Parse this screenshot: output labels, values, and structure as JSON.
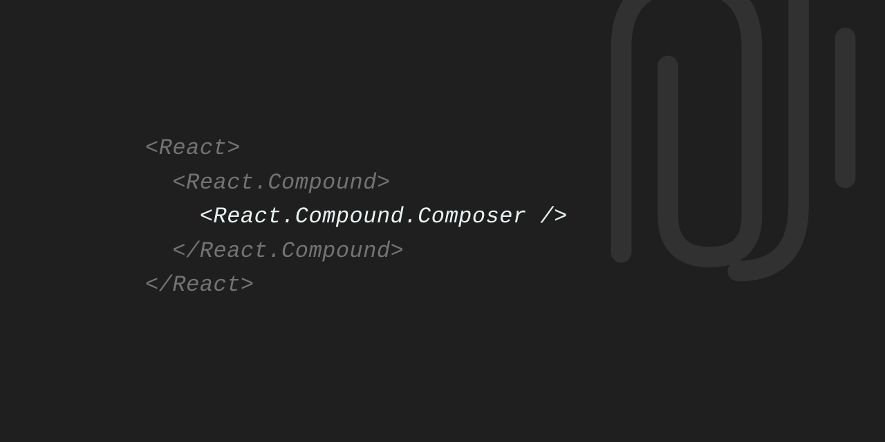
{
  "code": {
    "line1": "<React>",
    "line2": "  <React.Compound>",
    "line3": "    <React.Compound.Composer />",
    "line4": "  </React.Compound>",
    "line5": "</React>"
  }
}
